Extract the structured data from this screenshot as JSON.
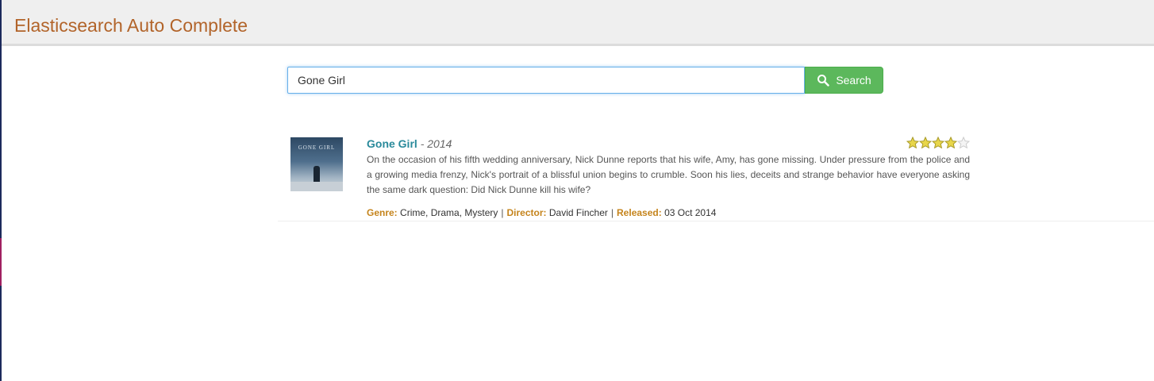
{
  "app": {
    "title": "Elasticsearch Auto Complete"
  },
  "search": {
    "value": "Gone Girl",
    "button_label": "Search",
    "button_color": "#5cb85c"
  },
  "results": [
    {
      "title": "Gone Girl",
      "separator": "-",
      "year": "2014",
      "rating": 4,
      "rating_max": 5,
      "plot": "On the occasion of his fifth wedding anniversary, Nick Dunne reports that his wife, Amy, has gone missing. Under pressure from the police and a growing media frenzy, Nick's portrait of a blissful union begins to crumble. Soon his lies, deceits and strange behavior have everyone asking the same dark question: Did Nick Dunne kill his wife?",
      "genre_label": "Genre:",
      "genre": "Crime, Drama, Mystery",
      "director_label": "Director:",
      "director": "David Fincher",
      "released_label": "Released:",
      "released": "03 Oct 2014",
      "poster_text": "GONE GIRL"
    }
  ],
  "colors": {
    "brand": "#b2642a",
    "title_link": "#2a8a9b",
    "meta_label": "#c5841c",
    "star_fill": "#e8d64a"
  }
}
